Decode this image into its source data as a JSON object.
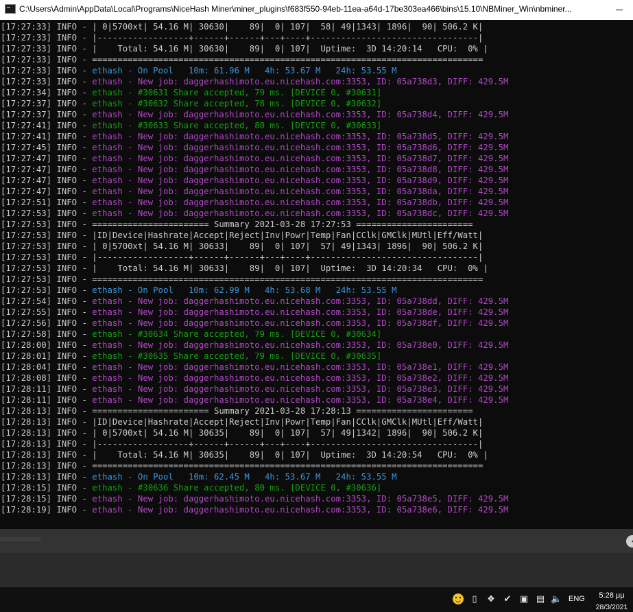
{
  "window": {
    "title": "C:\\Users\\Admin\\AppData\\Local\\Programs\\NiceHash Miner\\miner_plugins\\f683f550-94eb-11ea-a64d-17be303ea466\\bins\\15.10\\NBMiner_Win\\nbminer..."
  },
  "colors": {
    "background": "#0c0c0c",
    "text": "#cccccc",
    "pool": "#3a96dd",
    "job": "#b148c6",
    "share": "#13a10e"
  },
  "console": {
    "lines": [
      {
        "ts": "[17:27:33]",
        "lvl": "INFO",
        "text": "| 0|5700xt| 54.16 M| 30630|    89|  0| 107|  58| 49|1343| 1896|  90| 506.2 K|",
        "kind": "text"
      },
      {
        "ts": "[17:27:33]",
        "lvl": "INFO",
        "text": "|------------------+------+------+---+----+---------------------------------|",
        "kind": "text"
      },
      {
        "ts": "[17:27:33]",
        "lvl": "INFO",
        "text": "|    Total: 54.16 M| 30630|    89|  0| 107|  Uptime:  3D 14:20:14   CPU:  0% |",
        "kind": "text"
      },
      {
        "ts": "[17:27:33]",
        "lvl": "INFO",
        "text": "=============================================================================",
        "kind": "text"
      },
      {
        "ts": "[17:27:33]",
        "lvl": "INFO",
        "text": "ethash - On Pool   10m: 61.96 M   4h: 53.67 M   24h: 53.55 M",
        "kind": "pool"
      },
      {
        "ts": "[17:27:33]",
        "lvl": "INFO",
        "text": "ethash - New job: daggerhashimoto.eu.nicehash.com:3353, ID: 05a738d3, DIFF: 429.5M",
        "kind": "job"
      },
      {
        "ts": "[17:27:34]",
        "lvl": "INFO",
        "text": "ethash - #30631 Share accepted, 79 ms. [DEVICE 0, #30631]",
        "kind": "share"
      },
      {
        "ts": "[17:27:37]",
        "lvl": "INFO",
        "text": "ethash - #30632 Share accepted, 78 ms. [DEVICE 0, #30632]",
        "kind": "share"
      },
      {
        "ts": "[17:27:37]",
        "lvl": "INFO",
        "text": "ethash - New job: daggerhashimoto.eu.nicehash.com:3353, ID: 05a738d4, DIFF: 429.5M",
        "kind": "job"
      },
      {
        "ts": "[17:27:41]",
        "lvl": "INFO",
        "text": "ethash - #30633 Share accepted, 80 ms. [DEVICE 0, #30633]",
        "kind": "share"
      },
      {
        "ts": "[17:27:41]",
        "lvl": "INFO",
        "text": "ethash - New job: daggerhashimoto.eu.nicehash.com:3353, ID: 05a738d5, DIFF: 429.5M",
        "kind": "job"
      },
      {
        "ts": "[17:27:45]",
        "lvl": "INFO",
        "text": "ethash - New job: daggerhashimoto.eu.nicehash.com:3353, ID: 05a738d6, DIFF: 429.5M",
        "kind": "job"
      },
      {
        "ts": "[17:27:47]",
        "lvl": "INFO",
        "text": "ethash - New job: daggerhashimoto.eu.nicehash.com:3353, ID: 05a738d7, DIFF: 429.5M",
        "kind": "job"
      },
      {
        "ts": "[17:27:47]",
        "lvl": "INFO",
        "text": "ethash - New job: daggerhashimoto.eu.nicehash.com:3353, ID: 05a738d8, DIFF: 429.5M",
        "kind": "job"
      },
      {
        "ts": "[17:27:47]",
        "lvl": "INFO",
        "text": "ethash - New job: daggerhashimoto.eu.nicehash.com:3353, ID: 05a738d9, DIFF: 429.5M",
        "kind": "job"
      },
      {
        "ts": "[17:27:47]",
        "lvl": "INFO",
        "text": "ethash - New job: daggerhashimoto.eu.nicehash.com:3353, ID: 05a738da, DIFF: 429.5M",
        "kind": "job"
      },
      {
        "ts": "[17:27:51]",
        "lvl": "INFO",
        "text": "ethash - New job: daggerhashimoto.eu.nicehash.com:3353, ID: 05a738db, DIFF: 429.5M",
        "kind": "job"
      },
      {
        "ts": "[17:27:53]",
        "lvl": "INFO",
        "text": "ethash - New job: daggerhashimoto.eu.nicehash.com:3353, ID: 05a738dc, DIFF: 429.5M",
        "kind": "job"
      },
      {
        "ts": "[17:27:53]",
        "lvl": "INFO",
        "text": "======================= Summary 2021-03-28 17:27:53 =======================",
        "kind": "text"
      },
      {
        "ts": "[17:27:53]",
        "lvl": "INFO",
        "text": "|ID|Device|Hashrate|Accept|Reject|Inv|Powr|Temp|Fan|CClk|GMClk|MUtl|Eff/Watt|",
        "kind": "text"
      },
      {
        "ts": "[17:27:53]",
        "lvl": "INFO",
        "text": "| 0|5700xt| 54.16 M| 30633|    89|  0| 107|  57| 49|1343| 1896|  90| 506.2 K|",
        "kind": "text"
      },
      {
        "ts": "[17:27:53]",
        "lvl": "INFO",
        "text": "|------------------+------+------+---+----+---------------------------------|",
        "kind": "text"
      },
      {
        "ts": "[17:27:53]",
        "lvl": "INFO",
        "text": "|    Total: 54.16 M| 30633|    89|  0| 107|  Uptime:  3D 14:20:34   CPU:  0% |",
        "kind": "text"
      },
      {
        "ts": "[17:27:53]",
        "lvl": "INFO",
        "text": "=============================================================================",
        "kind": "text"
      },
      {
        "ts": "[17:27:53]",
        "lvl": "INFO",
        "text": "ethash - On Pool   10m: 62.99 M   4h: 53.68 M   24h: 53.55 M",
        "kind": "pool"
      },
      {
        "ts": "[17:27:54]",
        "lvl": "INFO",
        "text": "ethash - New job: daggerhashimoto.eu.nicehash.com:3353, ID: 05a738dd, DIFF: 429.5M",
        "kind": "job"
      },
      {
        "ts": "[17:27:55]",
        "lvl": "INFO",
        "text": "ethash - New job: daggerhashimoto.eu.nicehash.com:3353, ID: 05a738de, DIFF: 429.5M",
        "kind": "job"
      },
      {
        "ts": "[17:27:56]",
        "lvl": "INFO",
        "text": "ethash - New job: daggerhashimoto.eu.nicehash.com:3353, ID: 05a738df, DIFF: 429.5M",
        "kind": "job"
      },
      {
        "ts": "[17:27:58]",
        "lvl": "INFO",
        "text": "ethash - #30634 Share accepted, 79 ms. [DEVICE 0, #30634]",
        "kind": "share"
      },
      {
        "ts": "[17:28:00]",
        "lvl": "INFO",
        "text": "ethash - New job: daggerhashimoto.eu.nicehash.com:3353, ID: 05a738e0, DIFF: 429.5M",
        "kind": "job"
      },
      {
        "ts": "[17:28:01]",
        "lvl": "INFO",
        "text": "ethash - #30635 Share accepted, 79 ms. [DEVICE 0, #30635]",
        "kind": "share"
      },
      {
        "ts": "[17:28:04]",
        "lvl": "INFO",
        "text": "ethash - New job: daggerhashimoto.eu.nicehash.com:3353, ID: 05a738e1, DIFF: 429.5M",
        "kind": "job"
      },
      {
        "ts": "[17:28:08]",
        "lvl": "INFO",
        "text": "ethash - New job: daggerhashimoto.eu.nicehash.com:3353, ID: 05a738e2, DIFF: 429.5M",
        "kind": "job"
      },
      {
        "ts": "[17:28:11]",
        "lvl": "INFO",
        "text": "ethash - New job: daggerhashimoto.eu.nicehash.com:3353, ID: 05a738e3, DIFF: 429.5M",
        "kind": "job"
      },
      {
        "ts": "[17:28:11]",
        "lvl": "INFO",
        "text": "ethash - New job: daggerhashimoto.eu.nicehash.com:3353, ID: 05a738e4, DIFF: 429.5M",
        "kind": "job"
      },
      {
        "ts": "[17:28:13]",
        "lvl": "INFO",
        "text": "======================= Summary 2021-03-28 17:28:13 =======================",
        "kind": "text"
      },
      {
        "ts": "[17:28:13]",
        "lvl": "INFO",
        "text": "|ID|Device|Hashrate|Accept|Reject|Inv|Powr|Temp|Fan|CClk|GMClk|MUtl|Eff/Watt|",
        "kind": "text"
      },
      {
        "ts": "[17:28:13]",
        "lvl": "INFO",
        "text": "| 0|5700xt| 54.16 M| 30635|    89|  0| 107|  57| 49|1342| 1896|  90| 506.2 K|",
        "kind": "text"
      },
      {
        "ts": "[17:28:13]",
        "lvl": "INFO",
        "text": "|------------------+------+------+---+----+---------------------------------|",
        "kind": "text"
      },
      {
        "ts": "[17:28:13]",
        "lvl": "INFO",
        "text": "|    Total: 54.16 M| 30635|    89|  0| 107|  Uptime:  3D 14:20:54   CPU:  0% |",
        "kind": "text"
      },
      {
        "ts": "[17:28:13]",
        "lvl": "INFO",
        "text": "=============================================================================",
        "kind": "text"
      },
      {
        "ts": "[17:28:13]",
        "lvl": "INFO",
        "text": "ethash - On Pool   10m: 62.45 M   4h: 53.67 M   24h: 53.55 M",
        "kind": "pool"
      },
      {
        "ts": "[17:28:15]",
        "lvl": "INFO",
        "text": "ethash - #30636 Share accepted, 80 ms. [DEVICE 0, #30636]",
        "kind": "share"
      },
      {
        "ts": "[17:28:15]",
        "lvl": "INFO",
        "text": "ethash - New job: daggerhashimoto.eu.nicehash.com:3353, ID: 05a738e5, DIFF: 429.5M",
        "kind": "job"
      },
      {
        "ts": "[17:28:19]",
        "lvl": "INFO",
        "text": "ethash - New job: daggerhashimoto.eu.nicehash.com:3353, ID: 05a738e6, DIFF: 429.5M",
        "kind": "job"
      }
    ]
  },
  "taskbar": {
    "tray_icons": [
      "emoji-icon",
      "usb-drive-icon",
      "network-icon",
      "security-shield-icon",
      "printer-icon",
      "wifi-icon",
      "volume-icon"
    ],
    "language": "ENG",
    "time": "5:28 μμ",
    "date": "28/3/2021"
  }
}
